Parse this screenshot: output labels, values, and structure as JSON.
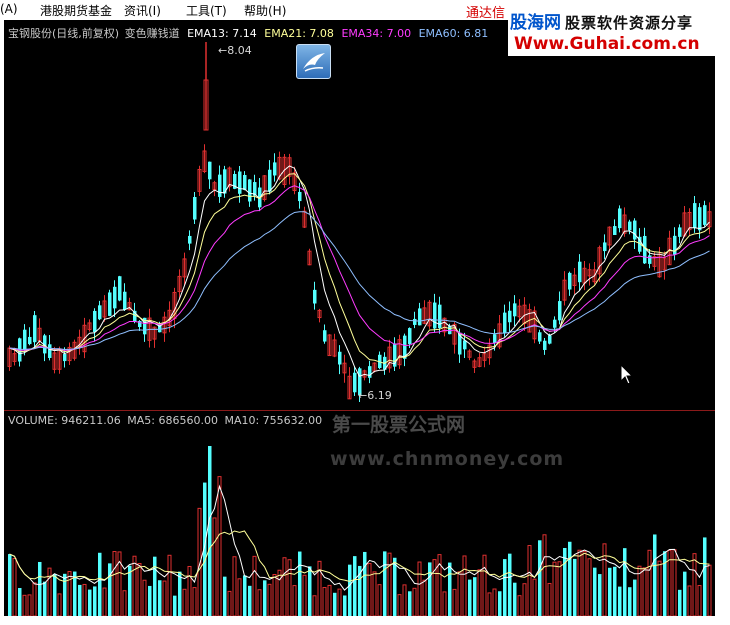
{
  "menu": {
    "items": [
      "(A)",
      "港股期货基金",
      "资讯(I)",
      "工具(T)",
      "帮助(H)"
    ],
    "tongda": "通达信"
  },
  "logo": {
    "cn": "股海网",
    "sub": "股票软件资源分享",
    "url": "Www.Guhai.com.cn"
  },
  "main_header": {
    "title": "宝钢股份(日线,前复权)",
    "indicator": "变色赚钱道",
    "ema13": "EMA13: 7.14",
    "ema21": "EMA21: 7.08",
    "ema34": "EMA34: 7.00",
    "ema60": "EMA60: 6.81"
  },
  "annotations": {
    "high": "8.04",
    "low": "6.19"
  },
  "volume_header": {
    "volume": "VOLUME: 946211.06",
    "ma5": "MA5: 686560.00",
    "ma10": "MA10: 755632.00"
  },
  "watermark": {
    "line1": "第一股票公式网",
    "line2": "www.chnmoney.com"
  },
  "colors": {
    "up": "#e03030",
    "down": "#54ffff",
    "ema13": "#ffffff",
    "ema21": "#ffff99",
    "ema34": "#ff3cff",
    "ema60": "#8fbfff",
    "separator": "#8b1a1a"
  },
  "icons": {
    "app": "app-bird-icon",
    "cursor": "mouse-pointer-icon"
  }
}
